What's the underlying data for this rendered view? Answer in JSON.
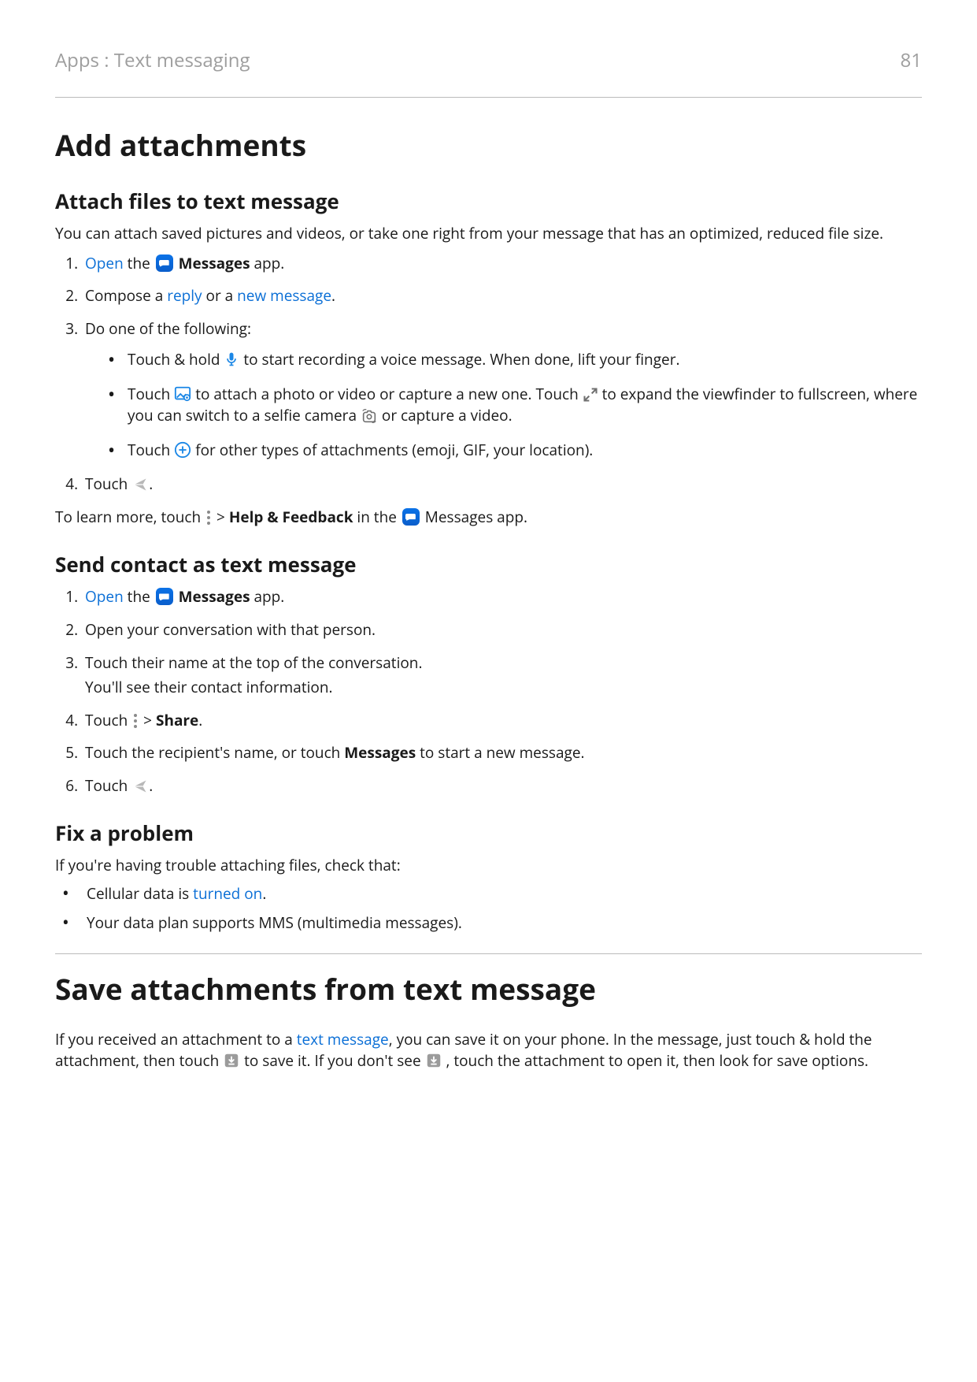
{
  "header": {
    "breadcrumb": "Apps : Text messaging",
    "page_number": "81"
  },
  "s1": {
    "h1": "Add attachments",
    "h2a": "Attach files to text message",
    "intro": "You can attach saved pictures and videos, or take one right from your message that has an optimized, reduced file size.",
    "step1": {
      "open": "Open",
      "the": " the ",
      "app": " Messages",
      "suffix": " app."
    },
    "step2": {
      "pre": "Compose a ",
      "reply": "reply",
      "or": " or a ",
      "newmsg": "new message",
      "dot": "."
    },
    "step3": "Do one of the following:",
    "b1": {
      "pre": "Touch & hold ",
      "post": " to start recording a voice message. When done, lift your finger."
    },
    "b2": {
      "pre": "Touch ",
      "mid1": " to attach a photo or video or capture a new one. Touch ",
      "mid2": " to expand the viewfinder to fullscreen, where you can switch to a selfie camera ",
      "post": " or capture a video."
    },
    "b3": {
      "pre": "Touch ",
      "post": " for other types of attachments (emoji, GIF, your location)."
    },
    "step4": {
      "pre": "Touch ",
      "post": "."
    },
    "learn": {
      "pre": "To learn more, touch ",
      "gt": " > ",
      "help": "Help & Feedback",
      "in": " in the ",
      "app": " Messages app."
    }
  },
  "s2": {
    "h2": "Send contact as text message",
    "step1": {
      "open": "Open",
      "the": " the ",
      "app": " Messages",
      "suffix": " app."
    },
    "step2": "Open your conversation with that person.",
    "step3": "Touch their name at the top of the conversation.",
    "step3b": "You'll see their contact information.",
    "step4": {
      "pre": "Touch ",
      "gt": " > ",
      "share": "Share",
      "dot": "."
    },
    "step5": {
      "pre": "Touch the recipient's name, or touch ",
      "msg": "Messages",
      "post": " to start a new message."
    },
    "step6": {
      "pre": "Touch ",
      "post": "."
    }
  },
  "s3": {
    "h2": "Fix a problem",
    "intro": "If you're having trouble attaching files, check that:",
    "b1": {
      "pre": "Cellular data is ",
      "link": "turned on",
      "dot": "."
    },
    "b2": "Your data plan supports MMS (multimedia messages)."
  },
  "s4": {
    "h1": "Save attachments from text message",
    "p": {
      "pre": "If you received an attachment to a ",
      "link": "text message",
      "mid1": ", you can save it on your phone. In the message, just touch & hold the attachment, then touch ",
      "mid2": " to save it. If you don't see ",
      "post": ", touch the attachment to open it, then look for save options."
    }
  }
}
